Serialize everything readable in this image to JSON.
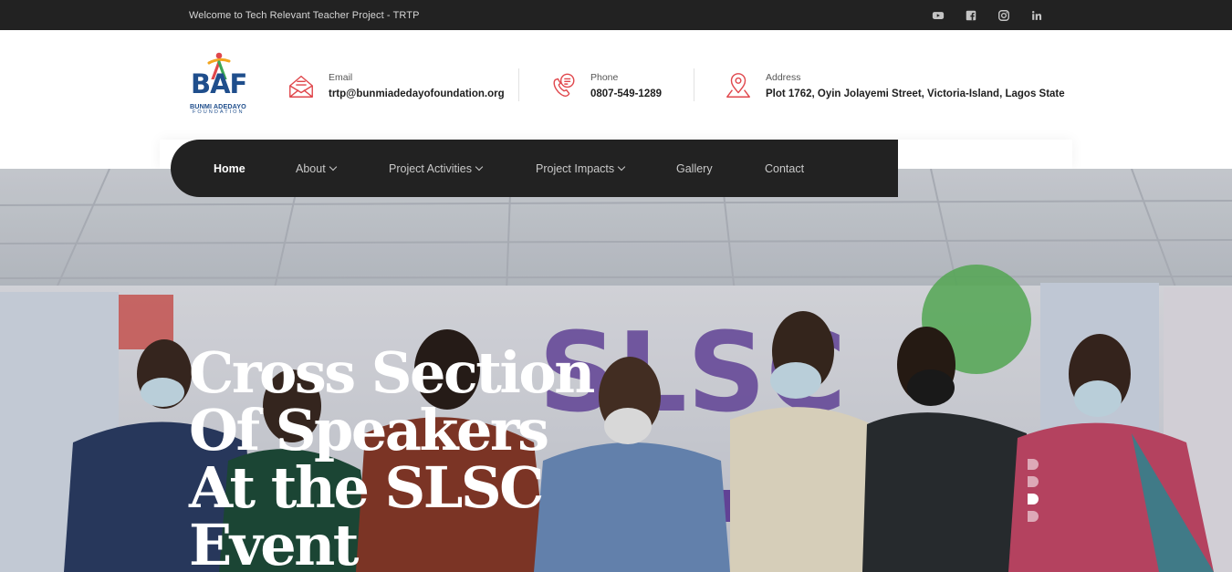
{
  "topbar": {
    "welcome": "Welcome to Tech Relevant Teacher Project - TRTP",
    "socials": [
      "youtube-icon",
      "facebook-icon",
      "instagram-icon",
      "linkedin-icon"
    ]
  },
  "logo": {
    "mark": "BAF",
    "line1": "BUNMI ADEDAYO",
    "line2": "FOUNDATION"
  },
  "contact": {
    "email": {
      "label": "Email",
      "value": "trtp@bunmiadedayofoundation.org",
      "icon": "envelope-icon"
    },
    "phone": {
      "label": "Phone",
      "value": "0807-549-1289",
      "icon": "phone-icon"
    },
    "address": {
      "label": "Address",
      "value": "Plot 1762, Oyin Jolayemi Street, Victoria-Island, Lagos State",
      "icon": "map-pin-icon"
    }
  },
  "nav": {
    "items": [
      {
        "label": "Home",
        "active": true,
        "dropdown": false
      },
      {
        "label": "About",
        "active": false,
        "dropdown": true
      },
      {
        "label": "Project Activities",
        "active": false,
        "dropdown": true
      },
      {
        "label": "Project Impacts",
        "active": false,
        "dropdown": true
      },
      {
        "label": "Gallery",
        "active": false,
        "dropdown": false
      },
      {
        "label": "Contact",
        "active": false,
        "dropdown": false
      }
    ]
  },
  "hero": {
    "title_lines": [
      "Cross Section",
      "Of Speakers",
      "At the SLSC",
      "Event"
    ],
    "slide_count": 4,
    "active_slide": 3
  },
  "colors": {
    "dark": "#222222",
    "accent": "#e0474c",
    "brand_blue": "#1f4e8c",
    "white": "#ffffff"
  }
}
